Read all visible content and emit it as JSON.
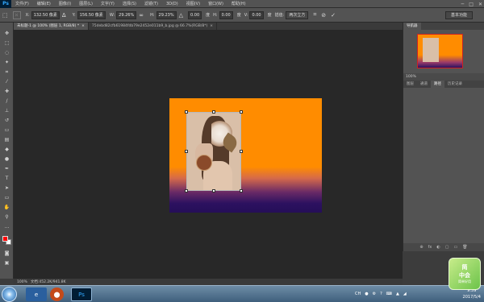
{
  "app": {
    "logo": "Ps"
  },
  "menu": [
    "文件(F)",
    "编辑(E)",
    "图像(I)",
    "图层(L)",
    "文字(Y)",
    "选择(S)",
    "滤镜(T)",
    "3D(D)",
    "视图(V)",
    "窗口(W)",
    "帮助(H)"
  ],
  "window_controls": [
    "─",
    "□",
    "✕"
  ],
  "options": {
    "x_label": "X:",
    "x_value": "132.50 像素",
    "y_label": "Y:",
    "y_value": "156.50 像素",
    "w_label": "W:",
    "w_value": "29.26%",
    "h_label": "H:",
    "h_value": "29.23%",
    "angle_value": "0.00",
    "angle_unit": "度",
    "h_skew_label": "H:",
    "h_skew_value": "0.00",
    "h_skew_unit": "度",
    "v_skew_label": "V:",
    "v_skew_value": "0.00",
    "v_skew_unit": "度",
    "interp_label": "插值:",
    "interp_value": "两次立方",
    "workspace": "基本功能"
  },
  "tabs": [
    {
      "label": "未标题-1 @ 100% (图层 1, RGB/8) *",
      "active": true
    },
    {
      "label": "75debd82cfb61984fdb79e2452e011b9_b.jpg @ 66.7%(RGB/8*)",
      "active": false
    }
  ],
  "status": {
    "zoom": "100%",
    "doc": "文档:452.2K/941.8K"
  },
  "navigator": {
    "tabs": [
      "导航器"
    ],
    "zoom": "100%"
  },
  "layers": {
    "tabs": [
      "图层",
      "通道",
      "路径",
      "历史记录"
    ],
    "footer_icons": [
      "⊕",
      "fx",
      "◐",
      "▢",
      "▭",
      "🗑"
    ]
  },
  "watermark": {
    "main": "简",
    "main2": "中会",
    "sub": "简单好用"
  },
  "taskbar": {
    "apps": [
      "e",
      "⬤",
      "Ps"
    ],
    "tray": [
      "CH",
      "●",
      "⚙",
      "?",
      "⌨",
      "▲",
      "◢"
    ],
    "time": "9:59",
    "date": "2017/5/4"
  },
  "colors": {
    "foreground": "#ff0000",
    "background": "#ffffff",
    "doc_top": "#ff8c00",
    "doc_bottom": "#250e58"
  }
}
